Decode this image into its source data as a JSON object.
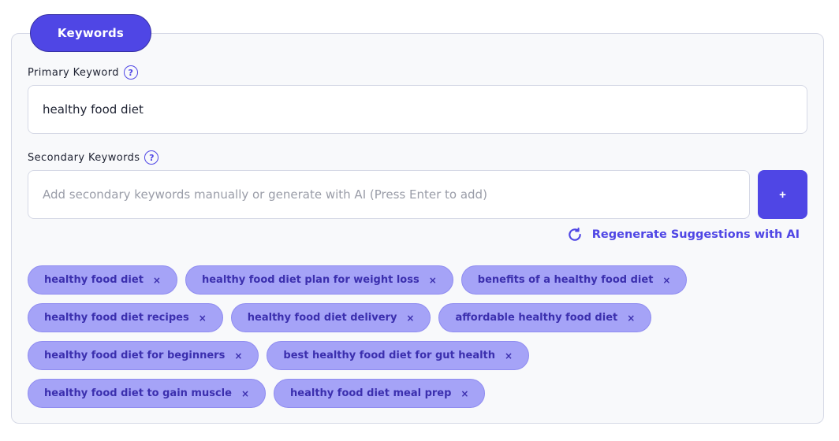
{
  "section": {
    "tab_label": "Keywords"
  },
  "primary": {
    "label": "Primary Keyword",
    "help_glyph": "?",
    "value": "healthy food diet"
  },
  "secondary": {
    "label": "Secondary Keywords",
    "help_glyph": "?",
    "placeholder": "Add secondary keywords manually or generate with AI (Press Enter to add)",
    "add_label": "+",
    "regenerate_label": "Regenerate Suggestions with AI"
  },
  "chip_remove_glyph": "×",
  "keywords": [
    "healthy food diet",
    "healthy food diet plan for weight loss",
    "benefits of a healthy food diet",
    "healthy food diet recipes",
    "healthy food diet delivery",
    "affordable healthy food diet",
    "healthy food diet for beginners",
    "best healthy food diet for gut health",
    "healthy food diet to gain muscle",
    "healthy food diet meal prep"
  ],
  "colors": {
    "accent": "#4f46e5",
    "chip_bg": "#a5a3f7",
    "chip_text": "#3b2fae",
    "panel_bg": "#f8f9fb"
  },
  "icons": {
    "help": "question-circle-icon",
    "refresh": "refresh-icon",
    "remove": "close-icon"
  }
}
